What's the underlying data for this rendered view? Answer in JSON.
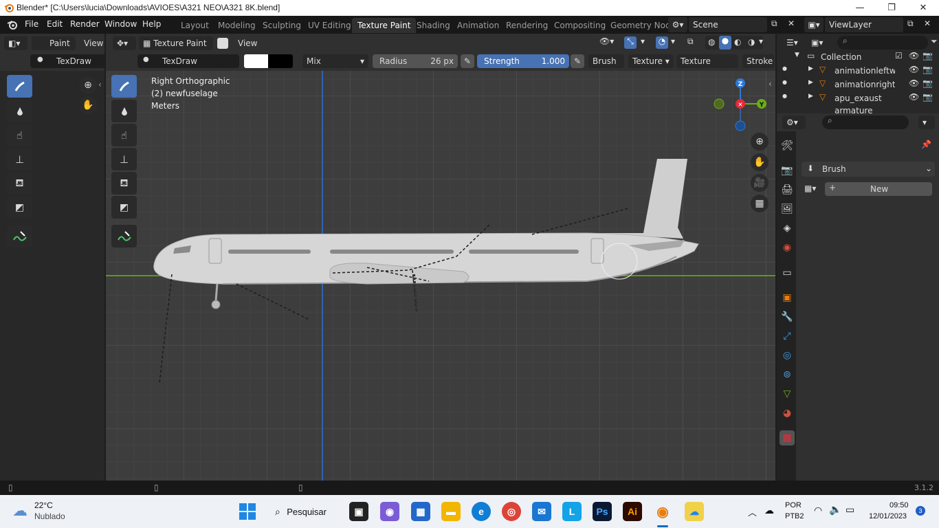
{
  "window": {
    "title": "Blender* [C:\\Users\\lucia\\Downloads\\AVIOES\\A321 NEO\\A321 8K.blend]"
  },
  "menu": [
    "File",
    "Edit",
    "Render",
    "Window",
    "Help"
  ],
  "workspaces": [
    "Layout",
    "Modeling",
    "Sculpting",
    "UV Editing",
    "Texture Paint",
    "Shading",
    "Animation",
    "Rendering",
    "Compositing",
    "Geometry Nod"
  ],
  "active_workspace": "Texture Paint",
  "scene": {
    "name": "Scene",
    "view_layer": "ViewLayer"
  },
  "left_editor": {
    "mode": "Paint",
    "view": "View",
    "brush": "TexDraw"
  },
  "viewport_header": {
    "mode": "Texture Paint",
    "view": "View"
  },
  "tool_settings": {
    "brush": "TexDraw",
    "blend": "Mix",
    "radius_label": "Radius",
    "radius_value": "26 px",
    "strength_label": "Strength",
    "strength_value": "1.000",
    "brush_menu": "Brush",
    "texture_menu": "Texture",
    "texture_mask_menu": "Texture Mask",
    "stroke_menu": "Stroke",
    "color": "#ffffff"
  },
  "viewport_info": {
    "view": "Right Orthographic",
    "object": "(2) newfuselage",
    "units": "Meters"
  },
  "gizmo": {
    "z": "Z",
    "y": "Y"
  },
  "outliner": {
    "collection": "Collection",
    "items": [
      "animationleftwir",
      "animationrighttw",
      "apu_exaust",
      "armature"
    ]
  },
  "properties": {
    "brush_label": "Brush",
    "new_label": "New"
  },
  "status": {
    "version": "3.1.2"
  },
  "taskbar": {
    "weather_temp": "22°C",
    "weather_desc": "Nublado",
    "search": "Pesquisar",
    "lang": "POR",
    "layout": "PTB2",
    "time": "09:50",
    "date": "12/01/2023",
    "notification_count": "3"
  },
  "colors": {
    "accent": "#4772b3",
    "active_tool": "#4772b3",
    "x_axis": "#e32a3a",
    "y_axis": "#6cad16",
    "z_axis": "#2f78d8"
  }
}
